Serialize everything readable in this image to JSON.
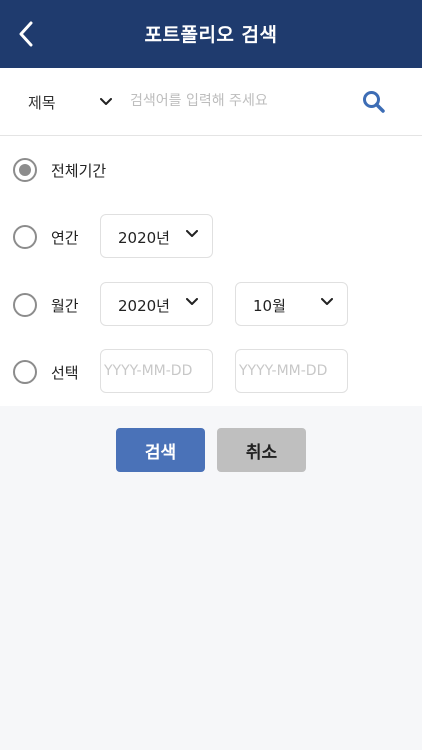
{
  "header": {
    "title": "포트폴리오 검색",
    "back_icon": "chevron-left-icon",
    "bg_color": "#1f3b6e"
  },
  "search": {
    "field_selected": "제목",
    "placeholder": "검색어를 입력해 주세요",
    "value": "",
    "search_icon": "search-icon",
    "accent_color": "#3d6db5"
  },
  "period_options": [
    {
      "label": "전체기간",
      "selected": true
    },
    {
      "label": "연간",
      "selected": false,
      "year": "2020년"
    },
    {
      "label": "월간",
      "selected": false,
      "year": "2020년",
      "month": "10월"
    },
    {
      "label": "선택",
      "selected": false,
      "start_placeholder": "YYYY-MM-DD",
      "end_placeholder": "YYYY-MM-DD"
    }
  ],
  "buttons": {
    "search_label": "검색",
    "cancel_label": "취소",
    "search_color": "#4a72b8",
    "cancel_color": "#bfbfbf"
  }
}
